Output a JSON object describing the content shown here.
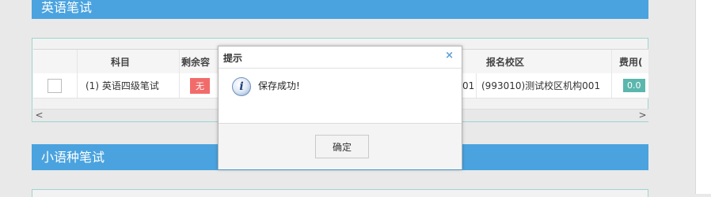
{
  "sections": {
    "english_title": "英语笔试",
    "minor_title": "小语种笔试"
  },
  "table": {
    "headers": {
      "subject": "科目",
      "remaining": "剩余容",
      "campus": "报名校区",
      "fee": "费用("
    },
    "row": {
      "subject": "(1) 英语四级笔试",
      "remaining": "无",
      "hidden_tail": "01",
      "campus": "(993010)测试校区机构001",
      "fee": "0.0"
    }
  },
  "dialog": {
    "title": "提示",
    "close_glyph": "×",
    "message": "保存成功!",
    "ok_label": "确定",
    "icon_glyph": "i"
  },
  "scrollbar": {
    "left_arrow": "<",
    "right_arrow": ">"
  },
  "colors": {
    "header_blue": "#4aa3df",
    "badge_red": "#f26b6b",
    "badge_teal": "#5bb7ad"
  }
}
